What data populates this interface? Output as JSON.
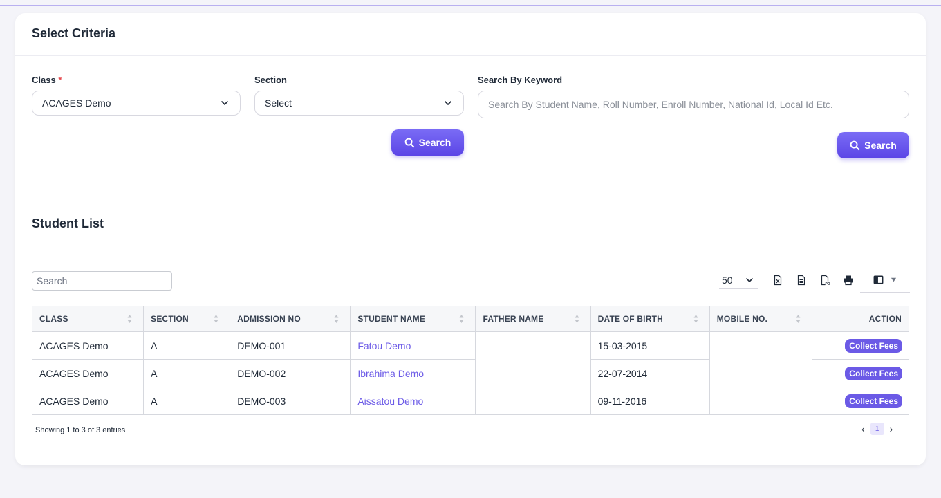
{
  "criteria": {
    "title": "Select Criteria",
    "class_label": "Class",
    "required_mark": "*",
    "class_value": "ACAGES Demo",
    "section_label": "Section",
    "section_value": "Select",
    "keyword_label": "Search By Keyword",
    "keyword_placeholder": "Search By Student Name, Roll Number, Enroll Number, National Id, Local Id Etc.",
    "search_button": "Search",
    "keyword_search_button": "Search"
  },
  "student_list": {
    "title": "Student List",
    "search_placeholder": "Search",
    "page_length": "50",
    "tools": [
      "excel-icon",
      "csv-icon",
      "pdf-icon",
      "print-icon",
      "columns-icon"
    ],
    "columns": [
      "CLASS",
      "SECTION",
      "ADMISSION NO",
      "STUDENT NAME",
      "FATHER NAME",
      "DATE OF BIRTH",
      "MOBILE NO.",
      "ACTION"
    ],
    "rows": [
      {
        "class": "ACAGES Demo",
        "section": "A",
        "admission_no": "DEMO-001",
        "student_name": "Fatou Demo",
        "father_name": "",
        "dob": "15-03-2015",
        "mobile": "",
        "action": "Collect Fees"
      },
      {
        "class": "ACAGES Demo",
        "section": "A",
        "admission_no": "DEMO-002",
        "student_name": "Ibrahima Demo",
        "father_name": "",
        "dob": "22-07-2014",
        "mobile": "",
        "action": "Collect Fees"
      },
      {
        "class": "ACAGES Demo",
        "section": "A",
        "admission_no": "DEMO-003",
        "student_name": "Aissatou Demo",
        "father_name": "",
        "dob": "09-11-2016",
        "mobile": "",
        "action": "Collect Fees"
      }
    ],
    "info": "Showing 1 to 3 of 3 entries",
    "current_page": "1",
    "prev": "‹",
    "next": "›"
  },
  "colors": {
    "accent": "#6b5ae6",
    "link": "#6d5ce7",
    "page_bg": "#f4f4f9"
  }
}
